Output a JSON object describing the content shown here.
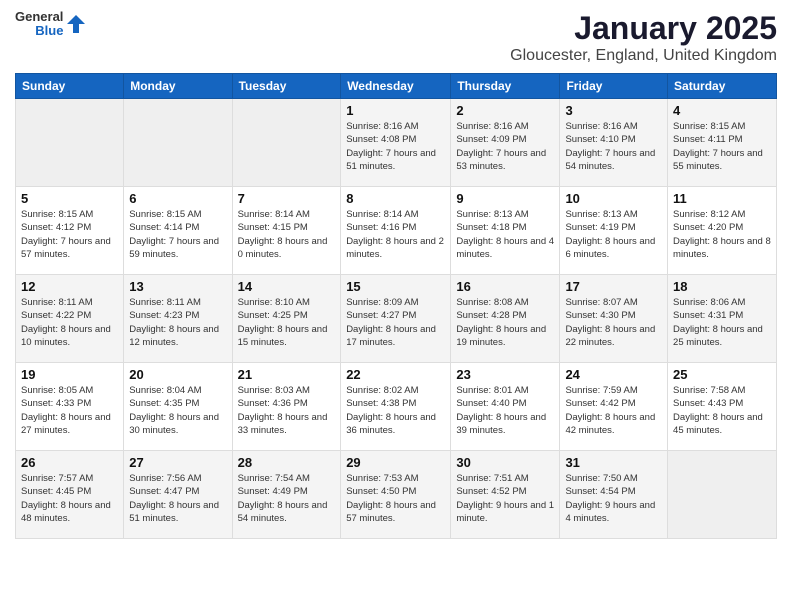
{
  "header": {
    "logo_general": "General",
    "logo_blue": "Blue",
    "month_title": "January 2025",
    "location": "Gloucester, England, United Kingdom"
  },
  "weekdays": [
    "Sunday",
    "Monday",
    "Tuesday",
    "Wednesday",
    "Thursday",
    "Friday",
    "Saturday"
  ],
  "weeks": [
    [
      {
        "day": "",
        "info": ""
      },
      {
        "day": "",
        "info": ""
      },
      {
        "day": "",
        "info": ""
      },
      {
        "day": "1",
        "info": "Sunrise: 8:16 AM\nSunset: 4:08 PM\nDaylight: 7 hours\nand 51 minutes."
      },
      {
        "day": "2",
        "info": "Sunrise: 8:16 AM\nSunset: 4:09 PM\nDaylight: 7 hours\nand 53 minutes."
      },
      {
        "day": "3",
        "info": "Sunrise: 8:16 AM\nSunset: 4:10 PM\nDaylight: 7 hours\nand 54 minutes."
      },
      {
        "day": "4",
        "info": "Sunrise: 8:15 AM\nSunset: 4:11 PM\nDaylight: 7 hours\nand 55 minutes."
      }
    ],
    [
      {
        "day": "5",
        "info": "Sunrise: 8:15 AM\nSunset: 4:12 PM\nDaylight: 7 hours\nand 57 minutes."
      },
      {
        "day": "6",
        "info": "Sunrise: 8:15 AM\nSunset: 4:14 PM\nDaylight: 7 hours\nand 59 minutes."
      },
      {
        "day": "7",
        "info": "Sunrise: 8:14 AM\nSunset: 4:15 PM\nDaylight: 8 hours\nand 0 minutes."
      },
      {
        "day": "8",
        "info": "Sunrise: 8:14 AM\nSunset: 4:16 PM\nDaylight: 8 hours\nand 2 minutes."
      },
      {
        "day": "9",
        "info": "Sunrise: 8:13 AM\nSunset: 4:18 PM\nDaylight: 8 hours\nand 4 minutes."
      },
      {
        "day": "10",
        "info": "Sunrise: 8:13 AM\nSunset: 4:19 PM\nDaylight: 8 hours\nand 6 minutes."
      },
      {
        "day": "11",
        "info": "Sunrise: 8:12 AM\nSunset: 4:20 PM\nDaylight: 8 hours\nand 8 minutes."
      }
    ],
    [
      {
        "day": "12",
        "info": "Sunrise: 8:11 AM\nSunset: 4:22 PM\nDaylight: 8 hours\nand 10 minutes."
      },
      {
        "day": "13",
        "info": "Sunrise: 8:11 AM\nSunset: 4:23 PM\nDaylight: 8 hours\nand 12 minutes."
      },
      {
        "day": "14",
        "info": "Sunrise: 8:10 AM\nSunset: 4:25 PM\nDaylight: 8 hours\nand 15 minutes."
      },
      {
        "day": "15",
        "info": "Sunrise: 8:09 AM\nSunset: 4:27 PM\nDaylight: 8 hours\nand 17 minutes."
      },
      {
        "day": "16",
        "info": "Sunrise: 8:08 AM\nSunset: 4:28 PM\nDaylight: 8 hours\nand 19 minutes."
      },
      {
        "day": "17",
        "info": "Sunrise: 8:07 AM\nSunset: 4:30 PM\nDaylight: 8 hours\nand 22 minutes."
      },
      {
        "day": "18",
        "info": "Sunrise: 8:06 AM\nSunset: 4:31 PM\nDaylight: 8 hours\nand 25 minutes."
      }
    ],
    [
      {
        "day": "19",
        "info": "Sunrise: 8:05 AM\nSunset: 4:33 PM\nDaylight: 8 hours\nand 27 minutes."
      },
      {
        "day": "20",
        "info": "Sunrise: 8:04 AM\nSunset: 4:35 PM\nDaylight: 8 hours\nand 30 minutes."
      },
      {
        "day": "21",
        "info": "Sunrise: 8:03 AM\nSunset: 4:36 PM\nDaylight: 8 hours\nand 33 minutes."
      },
      {
        "day": "22",
        "info": "Sunrise: 8:02 AM\nSunset: 4:38 PM\nDaylight: 8 hours\nand 36 minutes."
      },
      {
        "day": "23",
        "info": "Sunrise: 8:01 AM\nSunset: 4:40 PM\nDaylight: 8 hours\nand 39 minutes."
      },
      {
        "day": "24",
        "info": "Sunrise: 7:59 AM\nSunset: 4:42 PM\nDaylight: 8 hours\nand 42 minutes."
      },
      {
        "day": "25",
        "info": "Sunrise: 7:58 AM\nSunset: 4:43 PM\nDaylight: 8 hours\nand 45 minutes."
      }
    ],
    [
      {
        "day": "26",
        "info": "Sunrise: 7:57 AM\nSunset: 4:45 PM\nDaylight: 8 hours\nand 48 minutes."
      },
      {
        "day": "27",
        "info": "Sunrise: 7:56 AM\nSunset: 4:47 PM\nDaylight: 8 hours\nand 51 minutes."
      },
      {
        "day": "28",
        "info": "Sunrise: 7:54 AM\nSunset: 4:49 PM\nDaylight: 8 hours\nand 54 minutes."
      },
      {
        "day": "29",
        "info": "Sunrise: 7:53 AM\nSunset: 4:50 PM\nDaylight: 8 hours\nand 57 minutes."
      },
      {
        "day": "30",
        "info": "Sunrise: 7:51 AM\nSunset: 4:52 PM\nDaylight: 9 hours\nand 1 minute."
      },
      {
        "day": "31",
        "info": "Sunrise: 7:50 AM\nSunset: 4:54 PM\nDaylight: 9 hours\nand 4 minutes."
      },
      {
        "day": "",
        "info": ""
      }
    ]
  ]
}
